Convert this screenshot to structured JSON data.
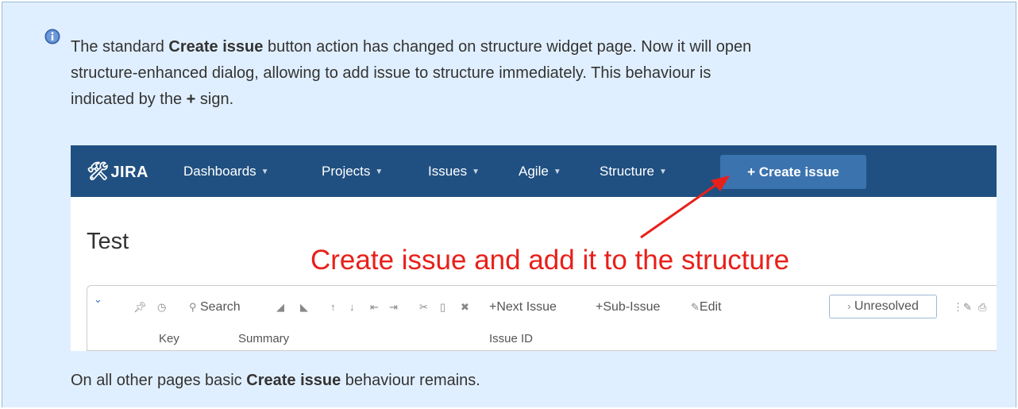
{
  "note": {
    "line1_pre": "The standard ",
    "line1_bold": "Create issue",
    "line1_post": " button action has changed on structure widget page. Now it will open",
    "line2": "structure-enhanced dialog, allowing to add issue to structure immediately. This behaviour is",
    "line3_pre": "indicated by the ",
    "line3_bold": "+",
    "line3_post": " sign."
  },
  "screenshot": {
    "logo": "JIRA",
    "nav": [
      {
        "label": "Dashboards"
      },
      {
        "label": "Projects"
      },
      {
        "label": "Issues"
      },
      {
        "label": "Agile"
      },
      {
        "label": "Structure"
      }
    ],
    "create_button": "+ Create issue",
    "page_title": "Test",
    "annotation": "Create issue and add it to the structure",
    "toolbar": {
      "search": "Search",
      "next_issue": "+Next Issue",
      "sub_issue": "+Sub-Issue",
      "edit": "Edit",
      "unresolved": "Unresolved"
    },
    "columns": [
      "Key",
      "Summary",
      "Issue ID"
    ]
  },
  "footer": {
    "pre": "On all other pages basic ",
    "bold": "Create issue",
    "post": " behaviour remains."
  },
  "colors": {
    "panel_bg": "#e0efff",
    "nav_bg": "#205081",
    "button_bg": "#3b73af",
    "annotation": "#e8201a"
  }
}
